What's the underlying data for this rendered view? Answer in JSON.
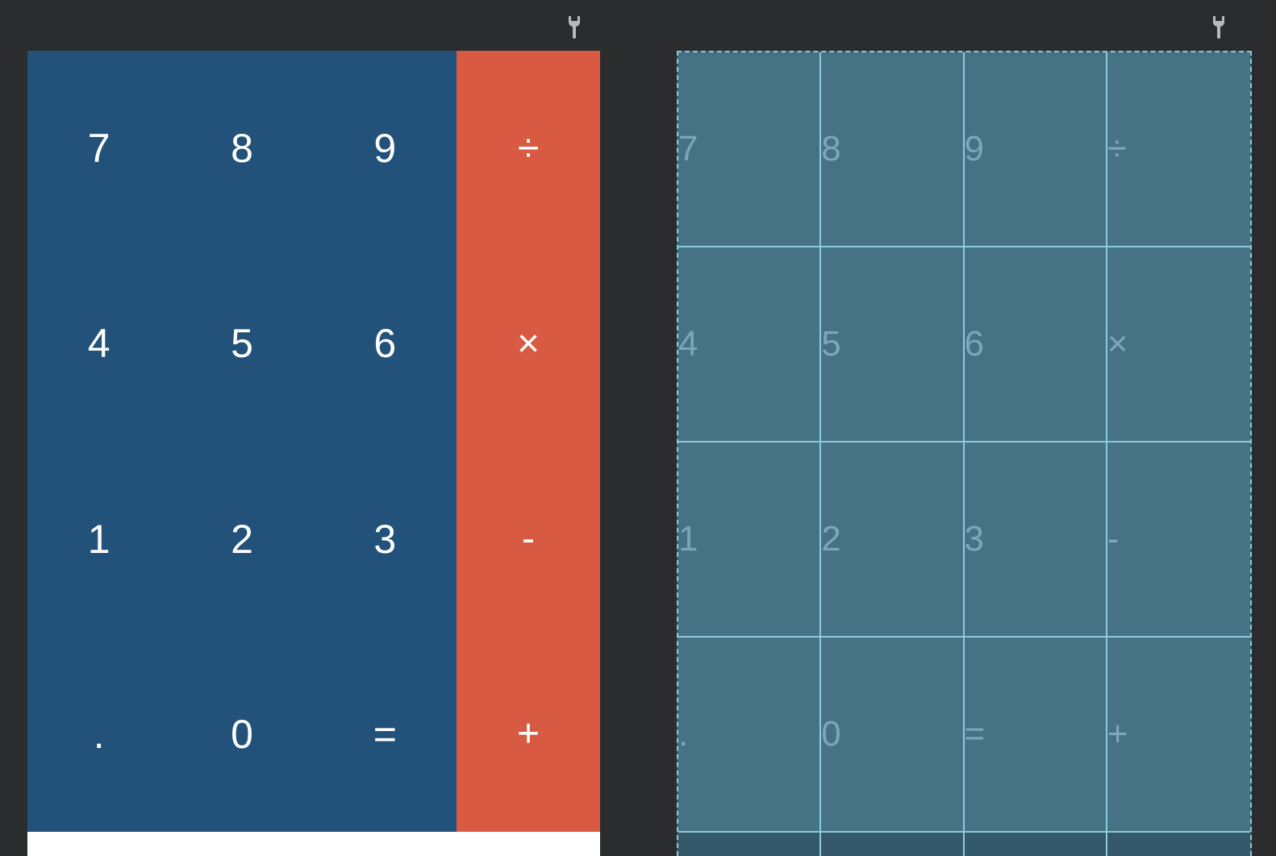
{
  "toolbar": {
    "left_icon": "wrench-icon",
    "right_icon": "wrench-icon"
  },
  "colors": {
    "background": "#2b2c2e",
    "digit_panel": "#22527a",
    "operator_panel": "#d95a43",
    "blueprint_fill": "#457383",
    "blueprint_lines": "#8fc9dc",
    "key_text": "#ffffff"
  },
  "design": {
    "digit_keys": [
      "7",
      "8",
      "9",
      "4",
      "5",
      "6",
      "1",
      "2",
      "3",
      ".",
      "0",
      "="
    ],
    "operator_keys": [
      "÷",
      "×",
      "-",
      "+"
    ]
  },
  "blueprint": {
    "cells": [
      "7",
      "8",
      "9",
      "÷",
      "4",
      "5",
      "6",
      "×",
      "1",
      "2",
      "3",
      "-",
      ".",
      "0",
      "=",
      "+"
    ]
  }
}
